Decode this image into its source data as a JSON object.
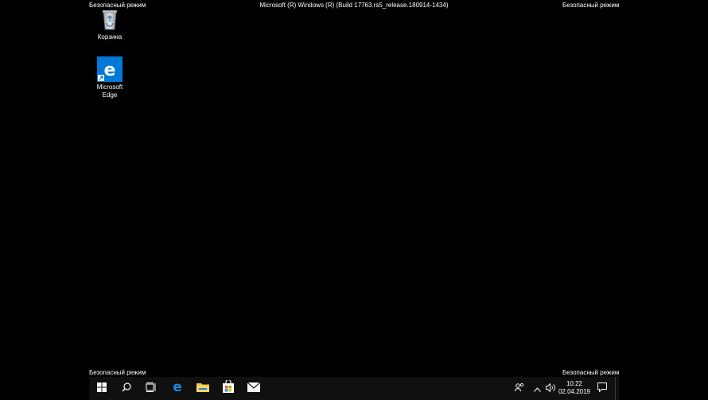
{
  "watermark": {
    "safe_mode": "Безопасный режим",
    "build": "Microsoft (R) Windows (R) (Build 17763.rs5_release.180914-1434)"
  },
  "desktop_icons": [
    {
      "label": "Корзина",
      "icon": "recycle-bin-icon"
    },
    {
      "label": "Microsoft Edge",
      "icon": "edge-icon"
    }
  ],
  "taskbar": {
    "buttons": [
      {
        "name": "start",
        "icon": "windows-logo-icon"
      },
      {
        "name": "search",
        "icon": "search-icon"
      },
      {
        "name": "task-view",
        "icon": "task-view-icon"
      },
      {
        "name": "edge",
        "icon": "edge-icon"
      },
      {
        "name": "file-explorer",
        "icon": "folder-icon"
      },
      {
        "name": "store",
        "icon": "store-icon"
      },
      {
        "name": "mail",
        "icon": "mail-icon"
      }
    ],
    "tray": {
      "people_icon": "people-icon",
      "chevron_icon": "chevron-up-icon",
      "volume_icon": "volume-icon",
      "notification_icon": "notification-icon"
    },
    "clock": {
      "time": "10:22",
      "date": "02.04.2019"
    }
  },
  "colors": {
    "desktop_bg": "#000000",
    "taskbar_bg": "#101010",
    "edge_blue": "#0078d7",
    "accent": "#1e88e5"
  }
}
